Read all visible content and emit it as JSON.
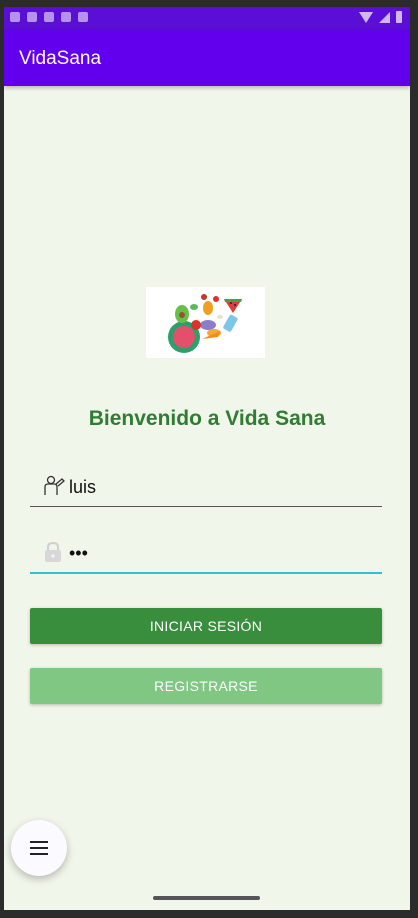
{
  "app_bar": {
    "title": "VidaSana"
  },
  "main": {
    "welcome": "Bienvenido a Vida Sana",
    "username": {
      "value": "luis",
      "icon": "user-icon"
    },
    "password": {
      "value": "•••",
      "icon": "lock-icon"
    },
    "login_button": "INICIAR SESIÓN",
    "register_button": "REGISTRARSE"
  },
  "fab": {
    "icon": "menu-icon"
  },
  "colors": {
    "app_bar": "#6200ee",
    "status_bar": "#5b0fd6",
    "background": "#f1f6ea",
    "welcome_text": "#2e7d32",
    "login_button": "#388e3c",
    "register_button": "#81c784",
    "focused_underline": "#26c6da"
  }
}
